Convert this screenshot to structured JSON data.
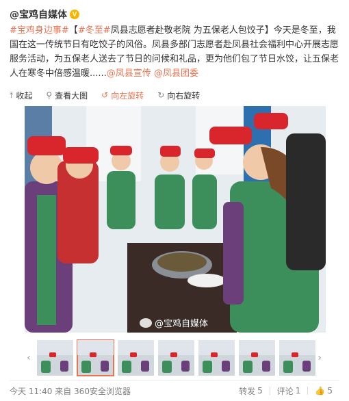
{
  "post": {
    "author": "@宝鸡自媒体",
    "verified_badge": "V",
    "topic1": "#宝鸡身边事#",
    "bracket_open": "【",
    "topic2": "#冬至#",
    "headline": "凤县志愿者赴敬老院 为五保老人包饺子",
    "bracket_close": "】",
    "body": "今天是冬至，我国在这一传统节日有吃饺子的风俗。凤县多部门志愿者赴凤县社会福利中心开展志愿服务活动，为五保老人送去了节日的问候和礼品，更为他们包了节日水饺，让五保老人在寒冬中倍感温暖......",
    "mention1": "@凤县宣传",
    "mention2": "@凤县团委"
  },
  "toolbar": {
    "collapse": "收起",
    "view_large": "查看大图",
    "rotate_left": "向左旋转",
    "rotate_right": "向右旋转"
  },
  "image": {
    "watermark": "@宝鸡自媒体",
    "description_colors": {
      "cap": "#d9262c",
      "vest": "#3c8f5a",
      "coat": "#6b3f7a"
    }
  },
  "thumbnails": {
    "count": 7,
    "selected_index": 1
  },
  "footer": {
    "time": "今天 11:40",
    "source": "来自 360安全浏览器",
    "repost_label": "转发",
    "repost_count": "5",
    "comment_label": "评论",
    "comment_count": "1",
    "like_count": "5"
  },
  "icons": {
    "collapse": "collapse-icon",
    "view_large": "magnify-icon",
    "rotate_left": "rotate-left-icon",
    "rotate_right": "rotate-right-icon",
    "like": "thumbs-up-icon"
  }
}
